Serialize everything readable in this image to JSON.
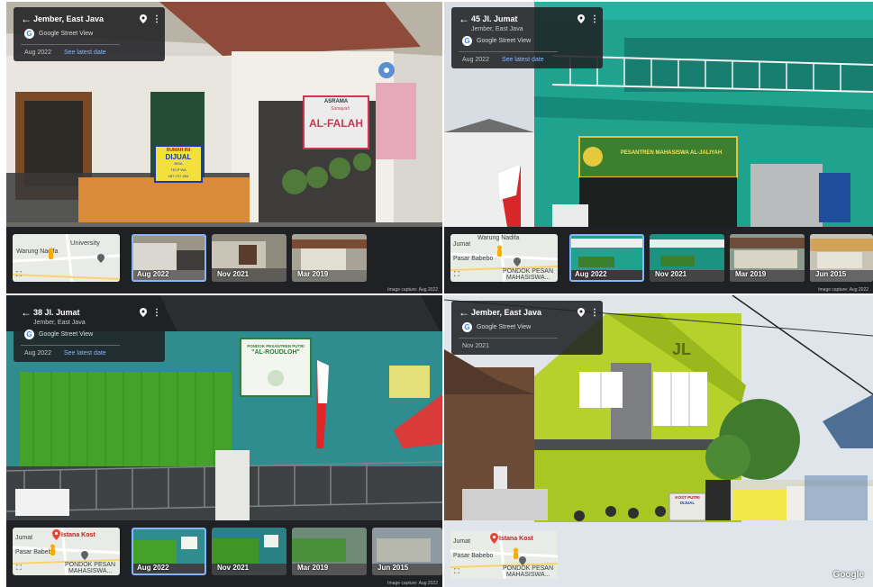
{
  "panels": [
    {
      "title": "Jember, East Java",
      "subtitle": "",
      "service": "Google Street View",
      "date": "Aug 2022",
      "latest_link": "See latest date",
      "minimap_labels": [
        "University",
        "Warung Nadifa"
      ],
      "thumbnails": [
        "Aug 2022",
        "Nov 2021",
        "Mar 2019"
      ],
      "capture": "Image capture: Aug 2022",
      "scene_text": {
        "sign_top": "ASRAMA",
        "sign_script": "Sumayah",
        "sign_main": "AL-FALAH",
        "for_sale_1": "RUMAH INI",
        "for_sale_2": "DIJUAL",
        "for_sale_3": "BISA",
        "for_sale_4": "TELP WA",
        "for_sale_5": "087-727-454"
      }
    },
    {
      "title": "45 Jl. Jumat",
      "subtitle": "Jember, East Java",
      "service": "Google Street View",
      "date": "Aug 2022",
      "latest_link": "See latest date",
      "minimap_labels": [
        "Warung Nadifa",
        "Pasar Babebo",
        "PONDOK PESAN",
        "MAHASISWA...",
        "Jumat"
      ],
      "thumbnails": [
        "Aug 2022",
        "Nov 2021",
        "Mar 2019",
        "Jun 2015"
      ],
      "capture": "Image capture: Aug 2022",
      "scene_text": {
        "banner": "PESANTREN MAHASISWA AL-JALIYAH"
      }
    },
    {
      "title": "38 Jl. Jumat",
      "subtitle": "Jember, East Java",
      "service": "Google Street View",
      "date": "Aug 2022",
      "latest_link": "See latest date",
      "minimap_labels": [
        "Istana Kost",
        "Pasar Babebo",
        "PONDOK PESAN",
        "MAHASISWA...",
        "Jumat"
      ],
      "thumbnails": [
        "Aug 2022",
        "Nov 2021",
        "Mar 2019",
        "Jun 2015"
      ],
      "capture": "Image capture: Aug 2022",
      "scene_text": {
        "sign_line1": "PONDOK PESANTREN PUTRI",
        "sign_line2": "\"AL-ROUDLOH\""
      }
    },
    {
      "title": "Jember, East Java",
      "subtitle": "",
      "service": "Google Street View",
      "date": "Nov 2021",
      "latest_link": "",
      "minimap_labels": [
        "Istana Kost",
        "Pasar Babebo",
        "PONDOK PESAN",
        "MAHASISWA...",
        "Jumat"
      ],
      "thumbnails": [],
      "capture": "",
      "watermark": "Google",
      "scene_text": {
        "building_letters": "JL",
        "kost_sign_1": "KOST PUTRI",
        "kost_sign_2": "DIJUAL"
      }
    }
  ],
  "colors": {
    "header_bg": "#202124",
    "link": "#8ab4f8",
    "strip_bg": "#202124"
  }
}
